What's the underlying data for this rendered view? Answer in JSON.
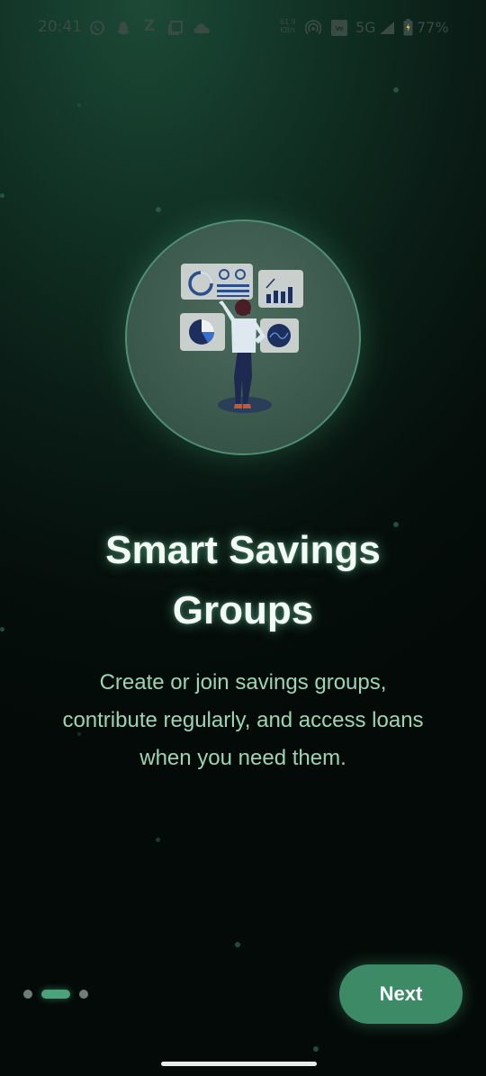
{
  "status_bar": {
    "time": "20:41",
    "speed_value": "61.9",
    "speed_unit": "KB/s",
    "network": "5G",
    "battery": "77%"
  },
  "onboarding": {
    "title": "Smart Savings Groups",
    "description": "Create or join savings groups, contribute regularly, and access loans when you need them.",
    "pager": {
      "count": 3,
      "active": 2
    },
    "next_label": "Next"
  },
  "colors": {
    "accent": "#3d8a66",
    "text_accent": "#9ad6b4",
    "background": "#050e0b"
  }
}
